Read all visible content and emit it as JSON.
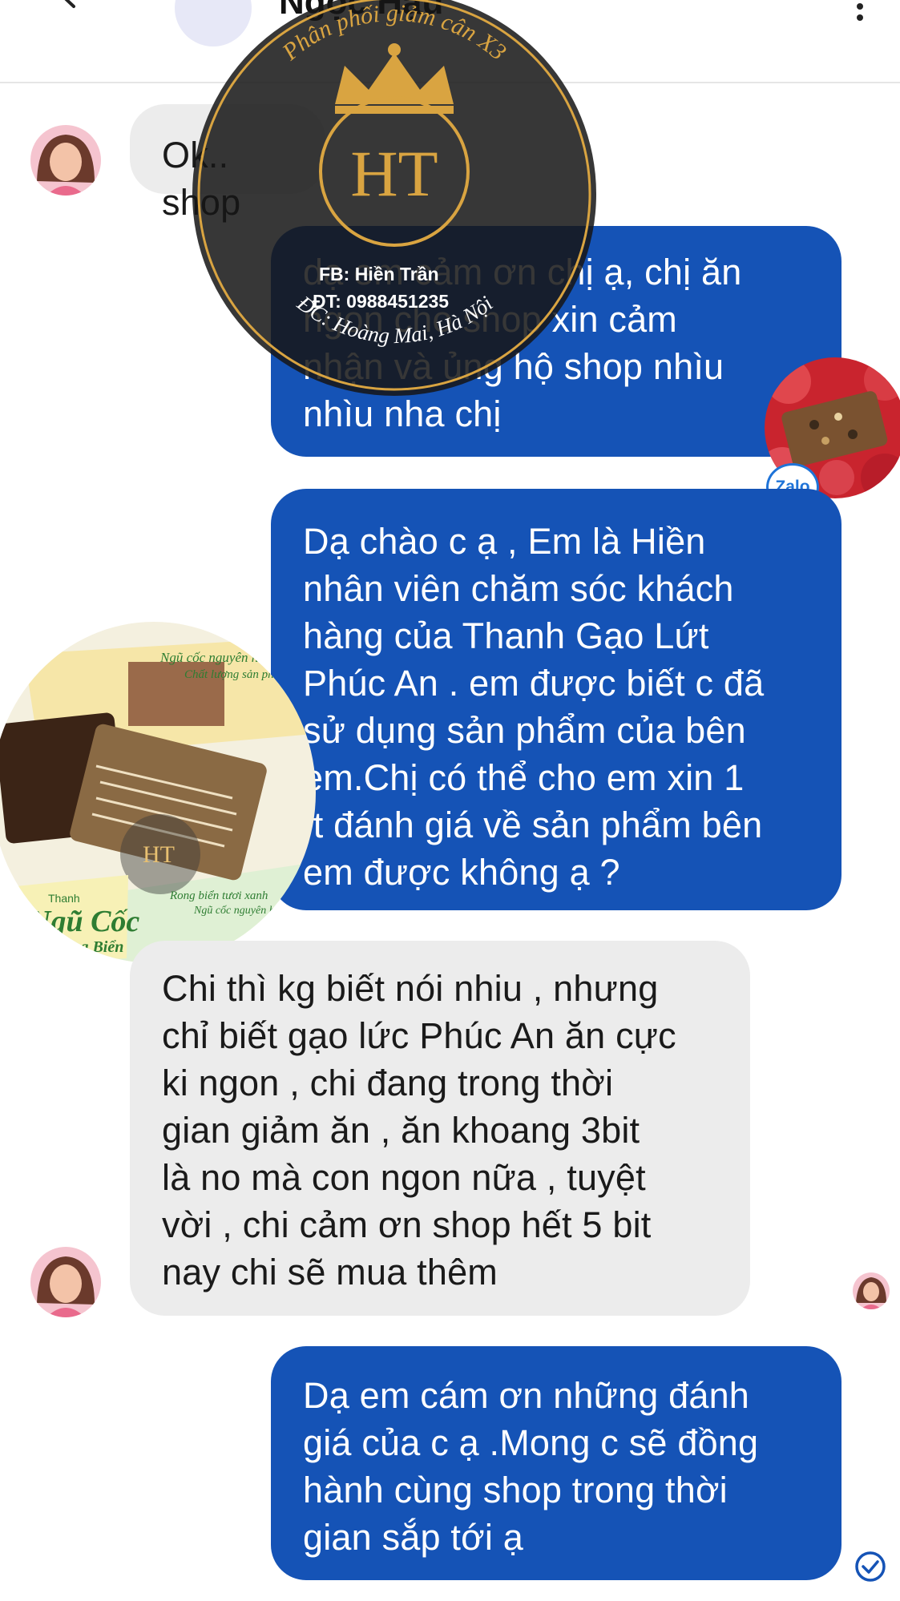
{
  "header": {
    "contact_name": "Ngọc Hậu",
    "back_icon": "arrow-left-icon",
    "more_icon": "more-vertical-icon"
  },
  "watermark": {
    "brand": "Phân phối giảm cân X3",
    "monogram": "HT",
    "fb": "FB: Hiền Trần",
    "phone": "ĐT: 0988451235",
    "address": "ĐC: Hoàng Mai, Hà Nội"
  },
  "messages": [
    {
      "side": "in",
      "text": "Ok.. shop"
    },
    {
      "side": "out",
      "text": "dạ em cảm ơn chị ạ, chị ăn\nngon cho shop xin cảm\nnhận và ủng hộ shop nhìu\nnhìu nha chị"
    },
    {
      "side": "out",
      "text": "Dạ chào c ạ , Em là Hiền\nnhân viên chăm sóc khách\nhàng của Thanh Gạo Lứt\nPhúc An . em được biết c đã\nsử dụng sản phẩm của bên\nem.Chị có thể cho em xin 1\nít đánh giá về sản phẩm bên\nem được không ạ ?"
    },
    {
      "side": "in",
      "text": "Chi thì kg biết nói nhiu , nhưng\nchỉ biết gạo lức Phúc An ăn cực\nki ngon , chi đang trong thời\ngian giảm ăn , ăn khoang 3bit\nlà no mà con ngon nữa , tuyệt\nvời , chi cảm ơn shop hết 5 bit\nnay chi sẽ mua thêm"
    },
    {
      "side": "out",
      "text": "Dạ em cám ơn những đánh\ngiá của c ạ .Mong c sẽ đồng\nhành cùng shop trong thời\ngian sắp tới ạ"
    }
  ],
  "product_photo": {
    "package_lines": [
      "Ngũ cốc nguyên hạt",
      "Chất lượng sản phẩm",
      "Rong biển tươi xanh",
      "Ngũ cốc nguyên hạt"
    ],
    "brand_small": "Thanh",
    "brand_big": "Ngũ Cốc",
    "brand_sub": "Rong Biển",
    "monogram": "HT"
  },
  "zalo_badge": "Zalo",
  "status_icon": "read-receipt-check-icon",
  "colors": {
    "outgoing_bubble": "#1553b6",
    "incoming_bubble": "#ececec",
    "watermark_gold": "#d9a441"
  }
}
